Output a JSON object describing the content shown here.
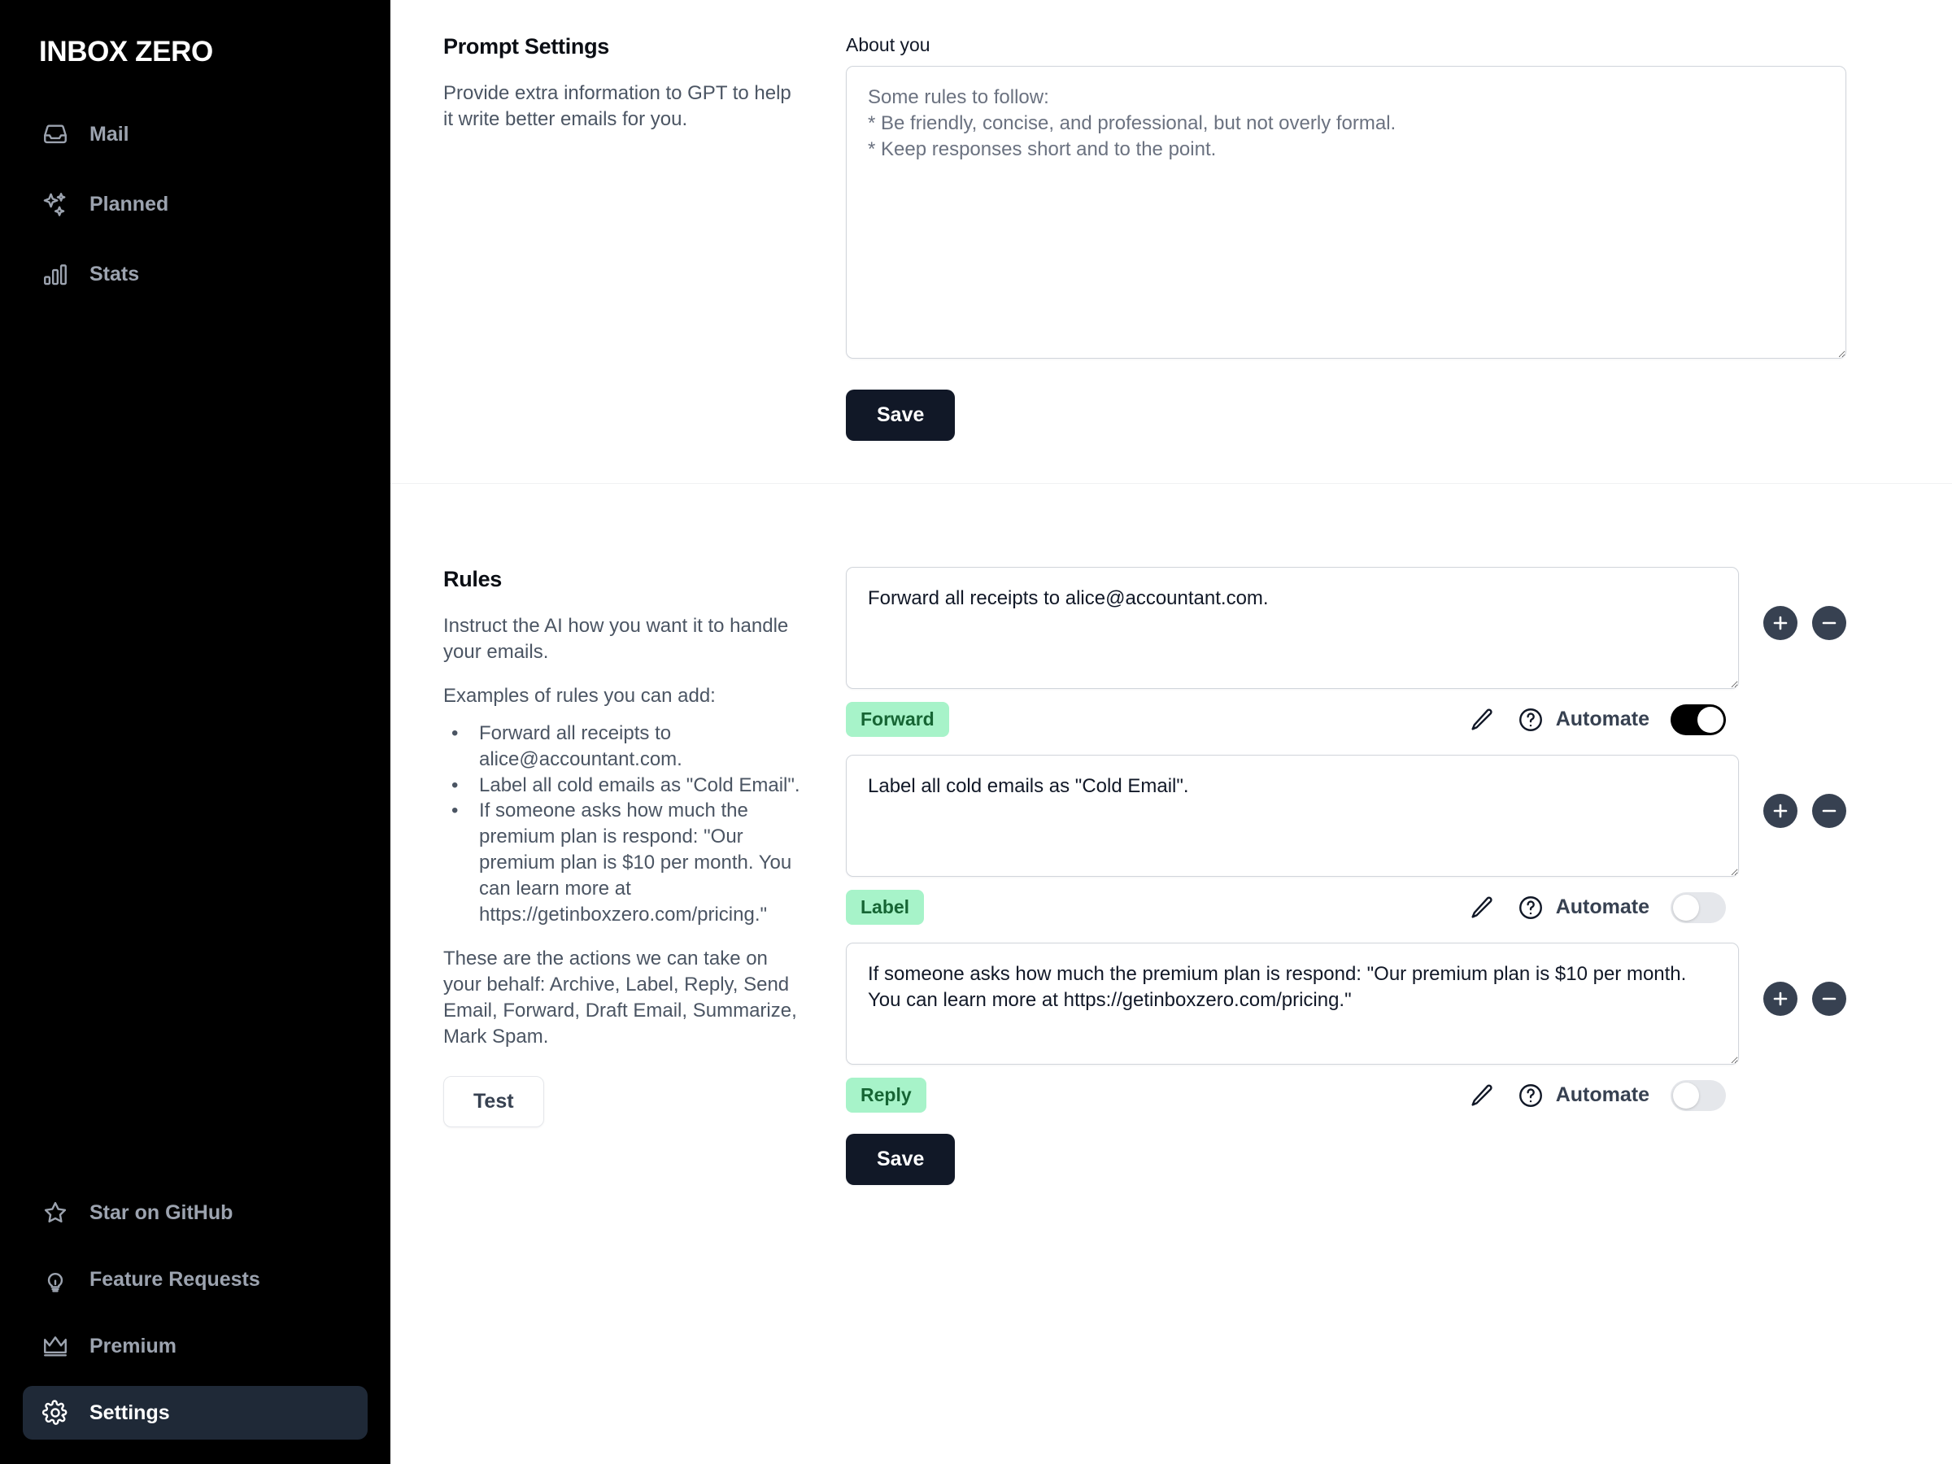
{
  "sidebar": {
    "brand": "INBOX ZERO",
    "top_items": [
      {
        "label": "Mail",
        "icon": "inbox-icon",
        "active": false
      },
      {
        "label": "Planned",
        "icon": "sparkles-icon",
        "active": false
      },
      {
        "label": "Stats",
        "icon": "bar-chart-icon",
        "active": false
      }
    ],
    "bottom_items": [
      {
        "label": "Star on GitHub",
        "icon": "star-icon",
        "active": false
      },
      {
        "label": "Feature Requests",
        "icon": "lightbulb-icon",
        "active": false
      },
      {
        "label": "Premium",
        "icon": "crown-icon",
        "active": false
      },
      {
        "label": "Settings",
        "icon": "gear-icon",
        "active": true
      }
    ]
  },
  "prompt_settings": {
    "title": "Prompt Settings",
    "description": "Provide extra information to GPT to help it write better emails for you.",
    "about_label": "About you",
    "about_placeholder": "Some rules to follow:\n* Be friendly, concise, and professional, but not overly formal.\n* Keep responses short and to the point.",
    "about_value": "",
    "save_label": "Save"
  },
  "rules": {
    "title": "Rules",
    "description": "Instruct the AI how you want it to handle your emails.",
    "examples_intro": "Examples of rules you can add:",
    "examples": [
      "Forward all receipts to alice@accountant.com.",
      "Label all cold emails as \"Cold Email\".",
      "If someone asks how much the premium plan is respond: \"Our premium plan is $10 per month. You can learn more at https://getinboxzero.com/pricing.\""
    ],
    "actions_note": "These are the actions we can take on your behalf: Archive, Label, Reply, Send Email, Forward, Draft Email, Summarize, Mark Spam.",
    "test_label": "Test",
    "save_label": "Save",
    "automate_label": "Automate",
    "add_icon": "plus-circle-icon",
    "remove_icon": "minus-circle-icon",
    "edit_icon": "pencil-icon",
    "help_icon": "question-mark-circle-icon",
    "badge_bg": "#a7f3c9",
    "badge_fg": "#166534",
    "items": [
      {
        "value": "Forward all receipts to alice@accountant.com.",
        "badge": "Forward",
        "automate": true,
        "automate_state": "on"
      },
      {
        "value": "Label all cold emails as \"Cold Email\".",
        "badge": "Label",
        "automate": false,
        "automate_state": "off"
      },
      {
        "value": "If someone asks how much the premium plan is respond: \"Our premium plan is $10 per month. You can learn more at https://getinboxzero.com/pricing.\"",
        "badge": "Reply",
        "automate": false,
        "automate_state": "off"
      }
    ]
  }
}
